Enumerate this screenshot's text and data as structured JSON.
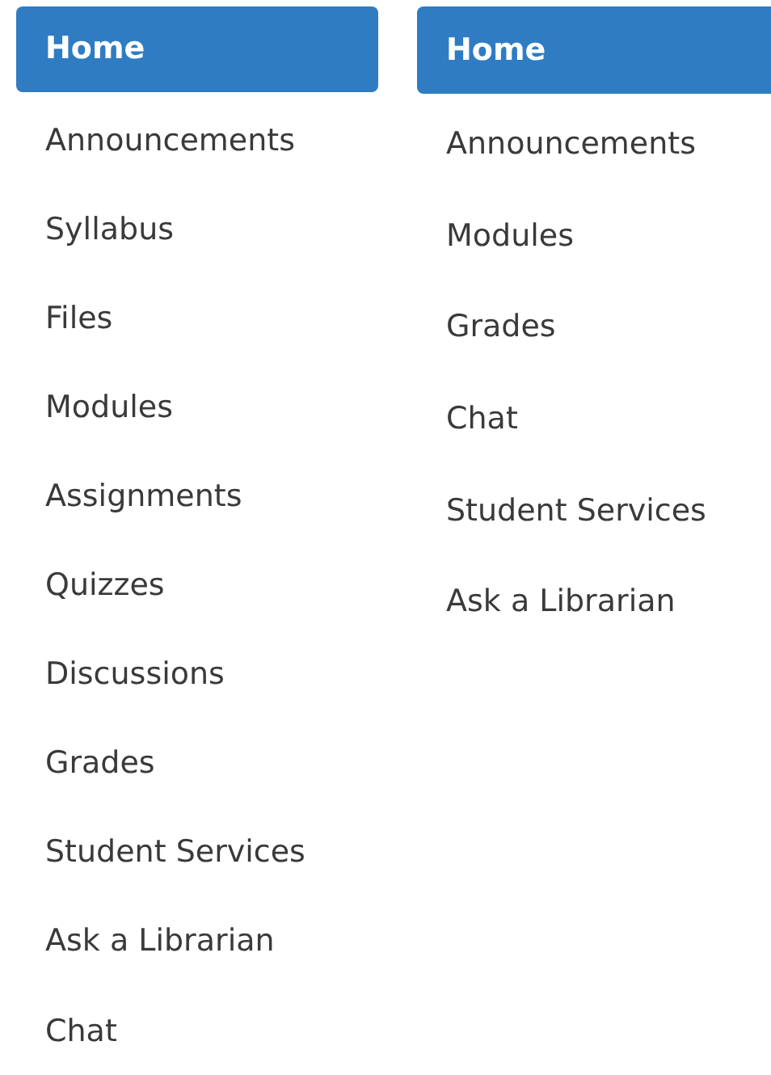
{
  "menus": [
    {
      "items": [
        {
          "label": "Home",
          "selected": true
        },
        {
          "label": "Announcements",
          "selected": false
        },
        {
          "label": "Syllabus",
          "selected": false
        },
        {
          "label": "Files",
          "selected": false
        },
        {
          "label": "Modules",
          "selected": false
        },
        {
          "label": "Assignments",
          "selected": false
        },
        {
          "label": "Quizzes",
          "selected": false
        },
        {
          "label": "Discussions",
          "selected": false
        },
        {
          "label": "Grades",
          "selected": false
        },
        {
          "label": "Student Services",
          "selected": false
        },
        {
          "label": "Ask a Librarian",
          "selected": false
        },
        {
          "label": "Chat",
          "selected": false
        }
      ]
    },
    {
      "items": [
        {
          "label": "Home",
          "selected": true
        },
        {
          "label": "Announcements",
          "selected": false
        },
        {
          "label": "Modules",
          "selected": false
        },
        {
          "label": "Grades",
          "selected": false
        },
        {
          "label": "Chat",
          "selected": false
        },
        {
          "label": "Student Services",
          "selected": false
        },
        {
          "label": "Ask a Librarian",
          "selected": false
        }
      ]
    }
  ]
}
